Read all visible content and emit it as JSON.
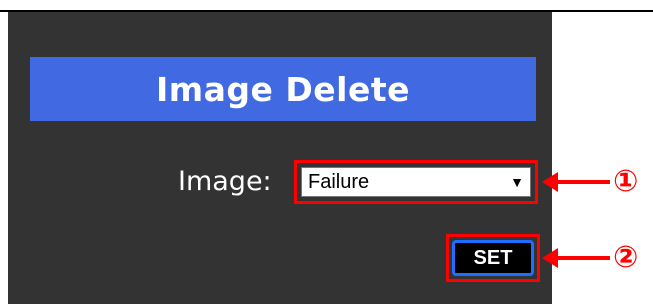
{
  "header": {
    "title": "Image Delete"
  },
  "form": {
    "image_label": "Image:",
    "image_select": {
      "selected": "Failure",
      "caret": "▼"
    },
    "set_button_label": "SET"
  },
  "annotations": {
    "marker_1": "①",
    "marker_2": "②"
  },
  "colors": {
    "panel": "#333333",
    "header": "#4169e1",
    "callout": "#ff0000",
    "button_border": "#1e6fff"
  }
}
